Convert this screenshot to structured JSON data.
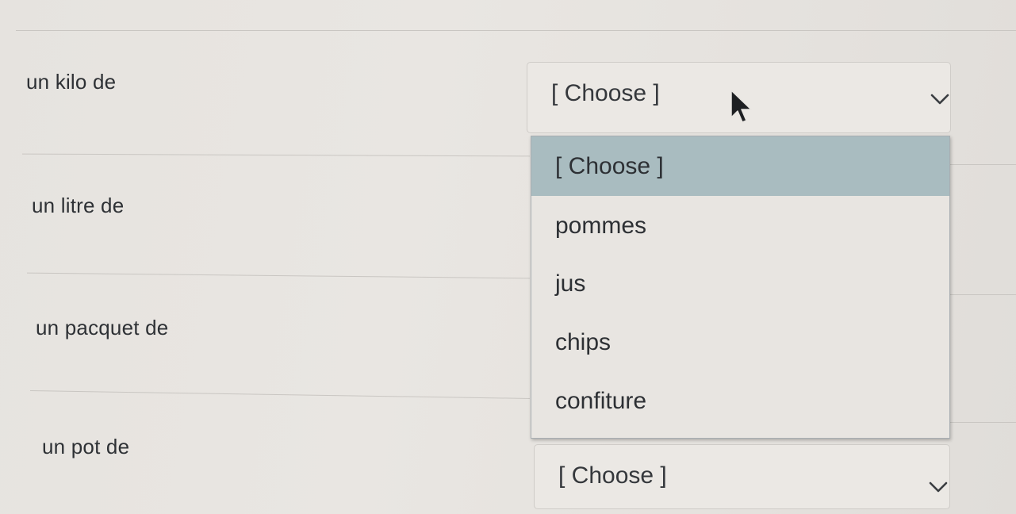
{
  "rows": [
    {
      "label": "un kilo de",
      "value": "[ Choose ]"
    },
    {
      "label": "un litre de"
    },
    {
      "label": "un pacquet de"
    },
    {
      "label": "un pot de",
      "value": "[ Choose ]"
    }
  ],
  "dropdown": {
    "options": [
      "[ Choose ]",
      "pommes",
      "jus",
      "chips",
      "confiture"
    ],
    "selected_index": 0
  },
  "icons": {
    "select_arrow": "chevron-down-icon",
    "cursor": "mouse-pointer-icon"
  },
  "colors": {
    "highlight": "#a9bcc0",
    "background": "#e7e4e0"
  }
}
